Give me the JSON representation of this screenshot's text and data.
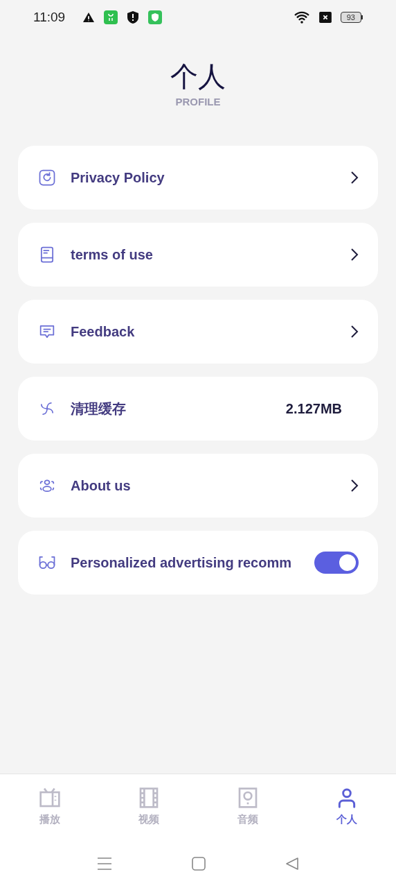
{
  "status_bar": {
    "time": "11:09",
    "battery": "93"
  },
  "header": {
    "title": "个人",
    "subtitle": "PROFILE"
  },
  "items": [
    {
      "kind": "link",
      "label": "Privacy Policy"
    },
    {
      "kind": "link",
      "label": "terms of use"
    },
    {
      "kind": "link",
      "label": "Feedback"
    },
    {
      "kind": "value",
      "label": "清理缓存",
      "value": "2.127MB"
    },
    {
      "kind": "link",
      "label": "About us"
    },
    {
      "kind": "toggle",
      "label": "Personalized advertising recomm",
      "on": true
    }
  ],
  "tabs": [
    {
      "label": "播放",
      "selected": false
    },
    {
      "label": "视频",
      "selected": false
    },
    {
      "label": "音频",
      "selected": false
    },
    {
      "label": "个人",
      "selected": true
    }
  ]
}
